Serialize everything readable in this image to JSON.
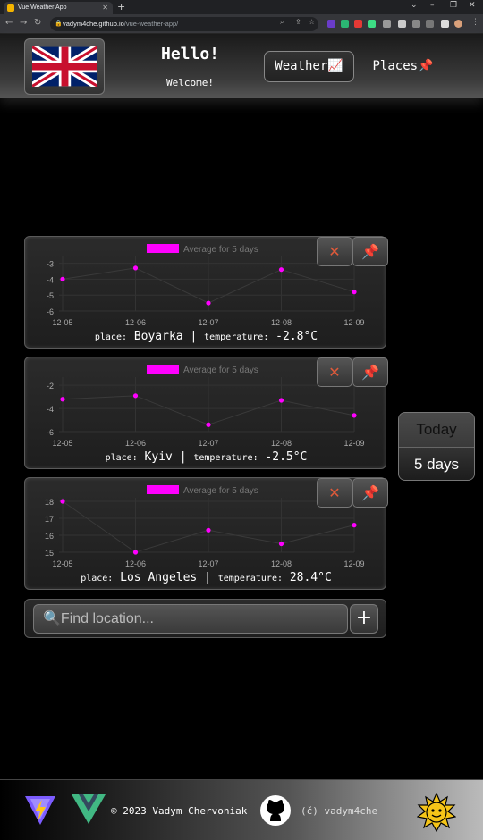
{
  "browser": {
    "tab_title": "Vue Weather App",
    "url_host": "vadym4che.github.io",
    "url_path": "/vue-weather-app/"
  },
  "header": {
    "greeting": "Hello!",
    "welcome": "Welcome!",
    "nav_weather": "Weather📈",
    "nav_places": "Places📌",
    "language_flag": "uk-flag-icon"
  },
  "cards": [
    {
      "legend": "Average for 5 days",
      "place_label": "place:",
      "place": "Boyarka",
      "separator": "|",
      "temp_label": "temperature:",
      "temperature": "-2.8°C",
      "chart_data": {
        "type": "line",
        "x": [
          "12-05",
          "12-06",
          "12-07",
          "12-08",
          "12-09"
        ],
        "y_ticks": [
          "-3",
          "-4",
          "-5",
          "-6"
        ],
        "series": [
          {
            "name": "Average for 5 days",
            "values": [
              -4.0,
              -3.3,
              -5.5,
              -3.4,
              -4.8
            ]
          }
        ],
        "ylim": [
          -6,
          -2.8
        ],
        "color": "#ff00ff"
      }
    },
    {
      "legend": "Average for 5 days",
      "place_label": "place:",
      "place": "Kyiv",
      "separator": "|",
      "temp_label": "temperature:",
      "temperature": "-2.5°C",
      "chart_data": {
        "type": "line",
        "x": [
          "12-05",
          "12-06",
          "12-07",
          "12-08",
          "12-09"
        ],
        "y_ticks": [
          "-2",
          "-4",
          "-6"
        ],
        "series": [
          {
            "name": "Average for 5 days",
            "values": [
              -3.2,
              -2.9,
              -5.4,
              -3.3,
              -4.6
            ]
          }
        ],
        "ylim": [
          -6,
          -1.6
        ],
        "color": "#ff00ff"
      }
    },
    {
      "legend": "Average for 5 days",
      "place_label": "place:",
      "place": "Los Angeles",
      "separator": "|",
      "temp_label": "temperature:",
      "temperature": "28.4°C",
      "chart_data": {
        "type": "line",
        "x": [
          "12-05",
          "12-06",
          "12-07",
          "12-08",
          "12-09"
        ],
        "y_ticks": [
          "18",
          "17",
          "16",
          "15"
        ],
        "series": [
          {
            "name": "Average for 5 days",
            "values": [
              18.0,
              15.0,
              16.3,
              15.5,
              16.6
            ]
          }
        ],
        "ylim": [
          15,
          18
        ],
        "color": "#ff00ff"
      }
    }
  ],
  "period": {
    "today": "Today",
    "five_days": "5 days",
    "selected": "5 days"
  },
  "search": {
    "placeholder": "Find location...",
    "add_label": "+"
  },
  "footer": {
    "copyright": "© 2023 Vadym Chervoniak",
    "handle": "(č) vadym4che"
  }
}
